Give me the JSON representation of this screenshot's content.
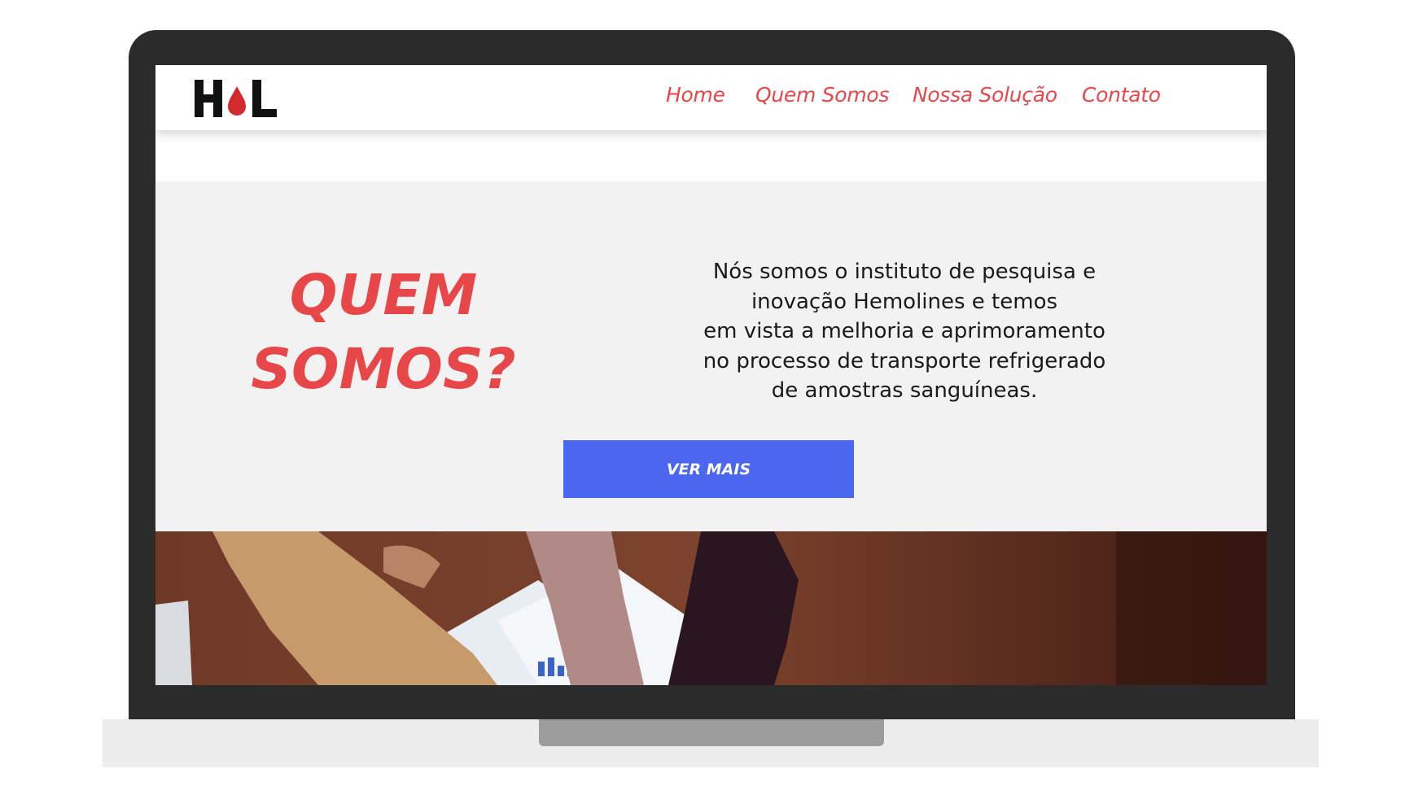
{
  "logo": {
    "text": "HL",
    "alt": "H●L"
  },
  "nav": {
    "items": [
      {
        "label": "Home"
      },
      {
        "label": "Quem Somos"
      },
      {
        "label": "Nossa Solução"
      },
      {
        "label": "Contato"
      }
    ]
  },
  "hero": {
    "title_lines": [
      "QUEM",
      "SOMOS?"
    ],
    "description_lines": [
      "Nós somos o instituto de pesquisa e",
      "inovação Hemolines e temos",
      "em vista a melhoria e aprimoramento",
      "no processo de transporte refrigerado",
      "de amostras sanguíneas."
    ],
    "button_label": "VER MAIS"
  },
  "colors": {
    "brand_red": "#e8474a",
    "button_blue": "#4b66ef",
    "hero_bg": "#f2f2f2",
    "bezel": "#2b2b2b"
  },
  "icons": {
    "logo_drop": "blood-drop-icon"
  }
}
